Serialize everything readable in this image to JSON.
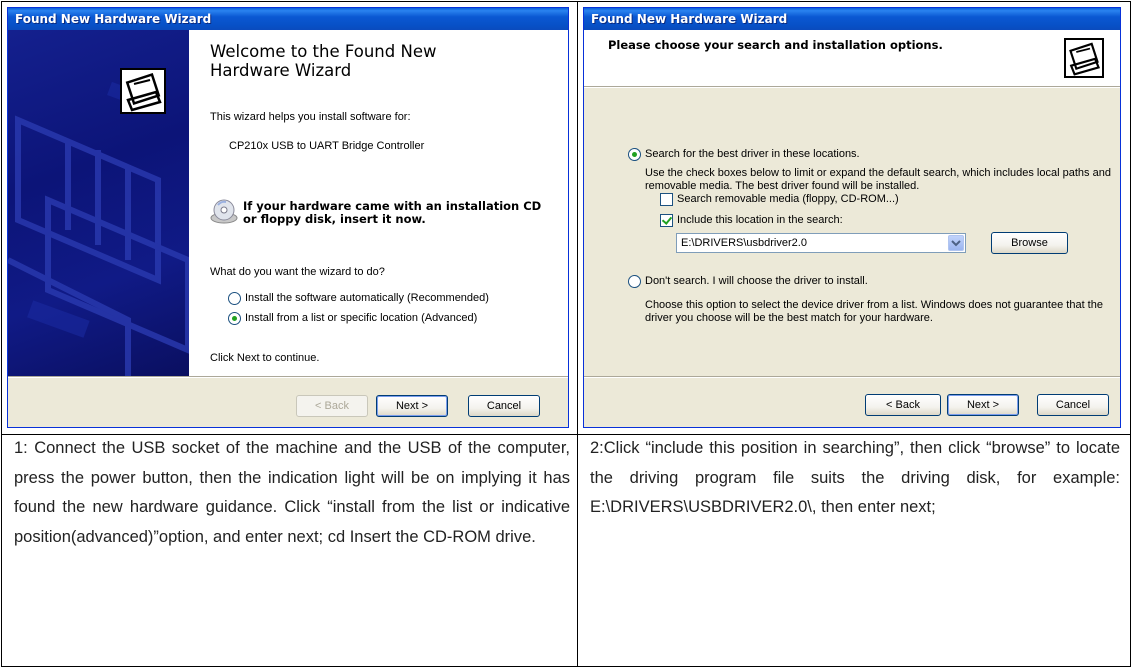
{
  "left_dialog": {
    "title": "Found New Hardware Wizard",
    "heading": "Welcome to the Found New Hardware Wizard",
    "intro": "This wizard helps you install software for:",
    "device": "CP210x USB to UART Bridge Controller",
    "cd_prompt": "If your hardware came with an installation CD or floppy disk, insert it now.",
    "question": "What do you want the wizard to do?",
    "options": [
      "Install the software automatically (Recommended)",
      "Install from a list or specific location (Advanced)"
    ],
    "selected_option": 1,
    "continue_text": "Click Next to continue.",
    "buttons": {
      "back": "< Back",
      "next": "Next >",
      "cancel": "Cancel"
    }
  },
  "right_dialog": {
    "title": "Found New Hardware Wizard",
    "header": "Please choose your search and installation options.",
    "option_search": "Search for the best driver in these locations.",
    "search_desc": "Use the check boxes below to limit or expand the default search, which includes local paths and removable media. The best driver found will be installed.",
    "check_removable": "Search removable media (floppy, CD-ROM...)",
    "check_removable_checked": false,
    "check_location": "Include this location in the search:",
    "check_location_checked": true,
    "location_value": "E:\\DRIVERS\\usbdriver2.0",
    "browse": "Browse",
    "option_dont_search": "Don't search. I will choose the driver to install.",
    "dont_search_desc": "Choose this option to select the device driver from a list.  Windows does not guarantee that the driver you choose will be the best match for your hardware.",
    "buttons": {
      "back": "< Back",
      "next": "Next >",
      "cancel": "Cancel"
    }
  },
  "captions": {
    "left": "1: Connect the USB socket of the machine and the USB of the computer, press the power button, then the indication light will be on implying it has found the new hardware guidance. Click “install from the list or indicative position(advanced)”option, and enter next; cd Insert the CD-ROM drive.",
    "right": "2:Click “include this position in searching”, then click “browse” to locate the driving program file suits the driving disk, for example: E:\\DRIVERS\\USBDRIVER2.0\\, then enter next;"
  },
  "colors": {
    "titlebar": "#0b58d3",
    "dialog_bg": "#ece9d8",
    "sidebar": "#0a1a8a",
    "radio_dot": "#21a121"
  },
  "icons": [
    "hardware-wizard-icon",
    "cd-icon",
    "dropdown-arrow-icon"
  ]
}
